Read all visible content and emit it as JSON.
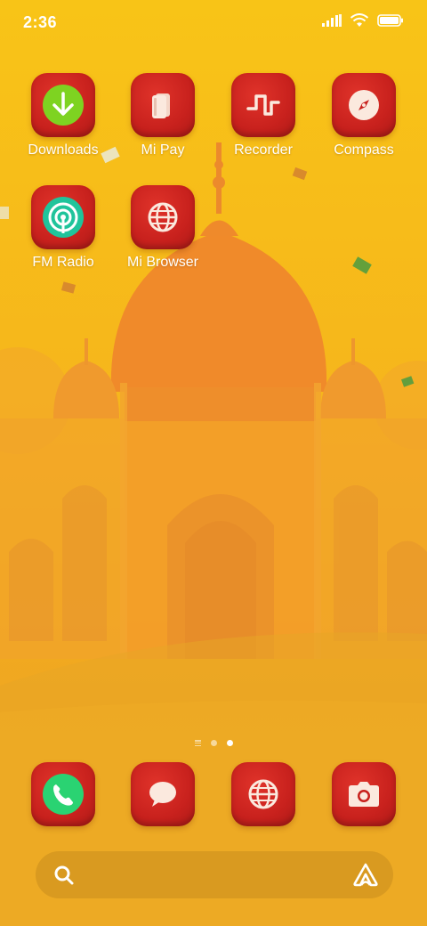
{
  "status_bar": {
    "time": "2:36",
    "icons": [
      "signal-icon",
      "wifi-icon",
      "battery-icon"
    ]
  },
  "home_apps": [
    {
      "label": "Downloads",
      "icon": "download-icon"
    },
    {
      "label": "Mi Pay",
      "icon": "wallet-icon"
    },
    {
      "label": "Recorder",
      "icon": "waveform-icon"
    },
    {
      "label": "Compass",
      "icon": "compass-icon"
    },
    {
      "label": "FM Radio",
      "icon": "radio-icon"
    },
    {
      "label": "Mi Browser",
      "icon": "globe-icon"
    }
  ],
  "page_indicator": {
    "pages": 3,
    "active": 2
  },
  "dock": [
    {
      "icon": "phone-icon"
    },
    {
      "icon": "messages-icon"
    },
    {
      "icon": "browser-icon"
    },
    {
      "icon": "camera-icon"
    }
  ],
  "search_bar": {
    "icons": [
      "search-icon",
      "assistant-icon"
    ]
  },
  "colors": {
    "background": "#f8c417",
    "icon_red": "#c8211d",
    "accent_green": "#4cd964",
    "text": "#ffffff"
  }
}
